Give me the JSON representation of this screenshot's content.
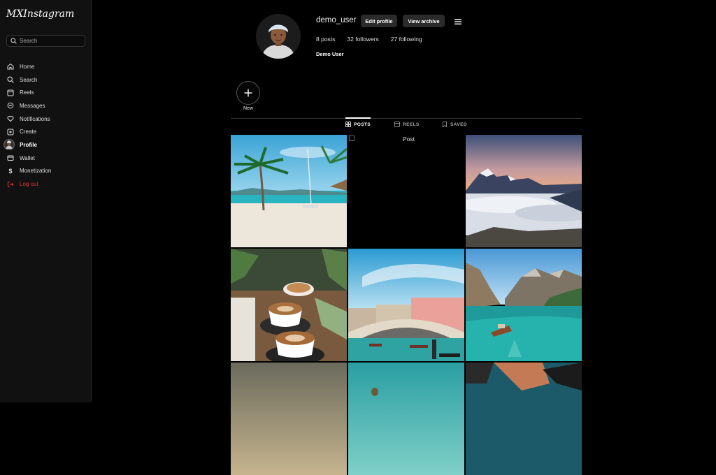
{
  "app": {
    "logo": "MXInstagram"
  },
  "search": {
    "placeholder": "Search"
  },
  "nav": {
    "items": [
      {
        "label": "Home",
        "icon": "home-icon"
      },
      {
        "label": "Search",
        "icon": "search-icon"
      },
      {
        "label": "Reels",
        "icon": "reels-icon"
      },
      {
        "label": "Messages",
        "icon": "messages-icon"
      },
      {
        "label": "Notifications",
        "icon": "heart-icon"
      },
      {
        "label": "Create",
        "icon": "plus-square-icon"
      },
      {
        "label": "Profile",
        "icon": "avatar",
        "active": true
      },
      {
        "label": "Wallet",
        "icon": "wallet-icon"
      },
      {
        "label": "Monetization",
        "icon": "dollar-icon"
      },
      {
        "label": "Log out",
        "icon": "logout-icon",
        "color": "#d33333"
      }
    ]
  },
  "profile": {
    "username": "demo_user",
    "edit_label": "Edit profile",
    "archive_label": "View archive",
    "posts": "8 posts",
    "followers": "32 followers",
    "following": "27 following",
    "full_name": "Demo User"
  },
  "highlights": {
    "new_label": "New"
  },
  "tabs": {
    "posts": "POSTS",
    "reels": "REELS",
    "saved": "SAVED"
  },
  "posts": [
    {
      "name": "post-beach-palm"
    },
    {
      "name": "post-broken-image",
      "alt": "Post"
    },
    {
      "name": "post-mountain-clouds"
    },
    {
      "name": "post-coffee-cups"
    },
    {
      "name": "post-venice-bridge"
    },
    {
      "name": "post-lake-boat"
    },
    {
      "name": "post-sand-dunes"
    },
    {
      "name": "post-balloon-sea"
    },
    {
      "name": "post-kayak"
    }
  ]
}
